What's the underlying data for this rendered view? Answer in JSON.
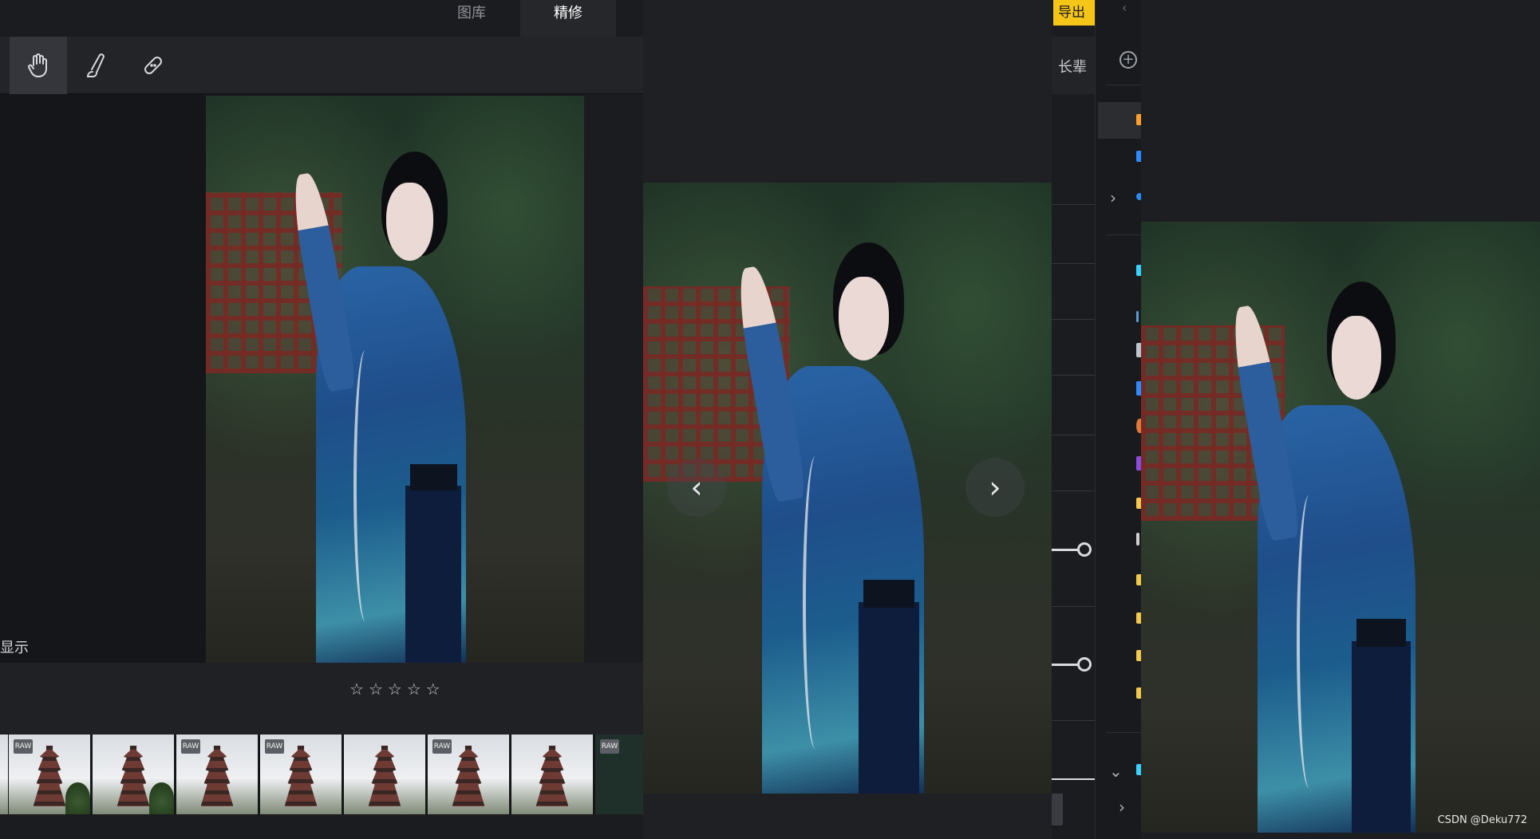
{
  "tabs": {
    "gallery": "图库",
    "retouch": "精修"
  },
  "left": {
    "display_label": "显示",
    "stars": [
      "☆",
      "☆",
      "☆",
      "☆",
      "☆"
    ],
    "thumb_badge": "RAW",
    "thumbs": [
      {
        "raw": true
      },
      {
        "raw": false
      },
      {
        "raw": true
      },
      {
        "raw": true
      },
      {
        "raw": false
      },
      {
        "raw": true
      },
      {
        "raw": false
      },
      {
        "raw": true
      }
    ]
  },
  "middle": {
    "prev": "‹",
    "next": "›"
  },
  "adjust": {
    "export_label": "导出",
    "elder_label": "长辈"
  },
  "layers": {
    "top_glyph": "‹",
    "add": "+"
  },
  "watermark": "CSDN @Deku772",
  "colors": {
    "accent": "#f5c518",
    "swatches": [
      "#ff9f2e",
      "#2e8bff",
      "#2e8bff",
      "#3ad0ff",
      "#5b9bd5",
      "#bcc6d0",
      "#2e8bff",
      "#e07a3b",
      "#8a4de0",
      "#f2c94c",
      "#d0d0d0",
      "#f2c94c",
      "#f2c94c",
      "#f2c94c",
      "#f2c94c",
      "#3ad0ff"
    ]
  }
}
